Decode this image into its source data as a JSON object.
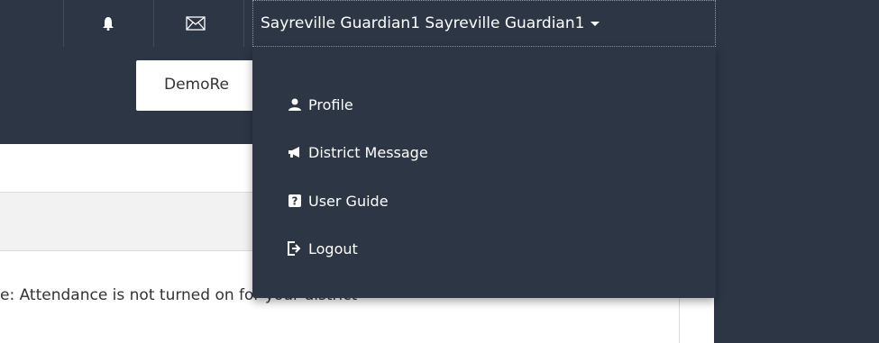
{
  "header": {
    "user_name": "Sayreville Guardian1 Sayreville Guardian1",
    "icons": [
      "bell-icon",
      "envelope-icon"
    ]
  },
  "toolbar": {
    "demo_button_label": "DemoRe"
  },
  "user_menu": {
    "items": [
      {
        "label": "Profile",
        "icon": "user-icon"
      },
      {
        "label": "District Message",
        "icon": "megaphone-icon"
      },
      {
        "label": "User Guide",
        "icon": "question-icon"
      },
      {
        "label": "Logout",
        "icon": "logout-icon"
      }
    ]
  },
  "main": {
    "notice_text": "e: Attendance is not turned on for your district"
  },
  "colors": {
    "nav_bg": "#2c3645",
    "content_bg": "#ffffff",
    "header_strip": "#f2f2f2"
  }
}
